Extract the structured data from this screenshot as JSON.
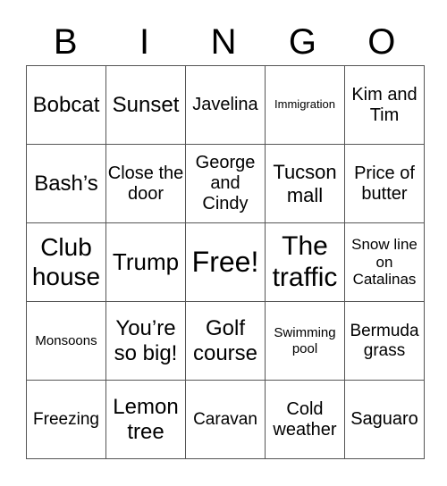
{
  "header": [
    "B",
    "I",
    "N",
    "G",
    "O"
  ],
  "rows": [
    [
      "Bobcat",
      "Sunset",
      "Javelina",
      "Immigration",
      "Kim and Tim"
    ],
    [
      "Bash’s",
      "Close the door",
      "George and Cindy",
      "Tucson mall",
      "Price of butter"
    ],
    [
      "Club house",
      "Trump",
      "Free!",
      "The traffic",
      "Snow line on Catalinas"
    ],
    [
      "Monsoons",
      "You’re so big!",
      "Golf course",
      "Swimming pool",
      "Bermuda grass"
    ],
    [
      "Freezing",
      "Lemon tree",
      "Caravan",
      "Cold weather",
      "Saguaro"
    ]
  ]
}
